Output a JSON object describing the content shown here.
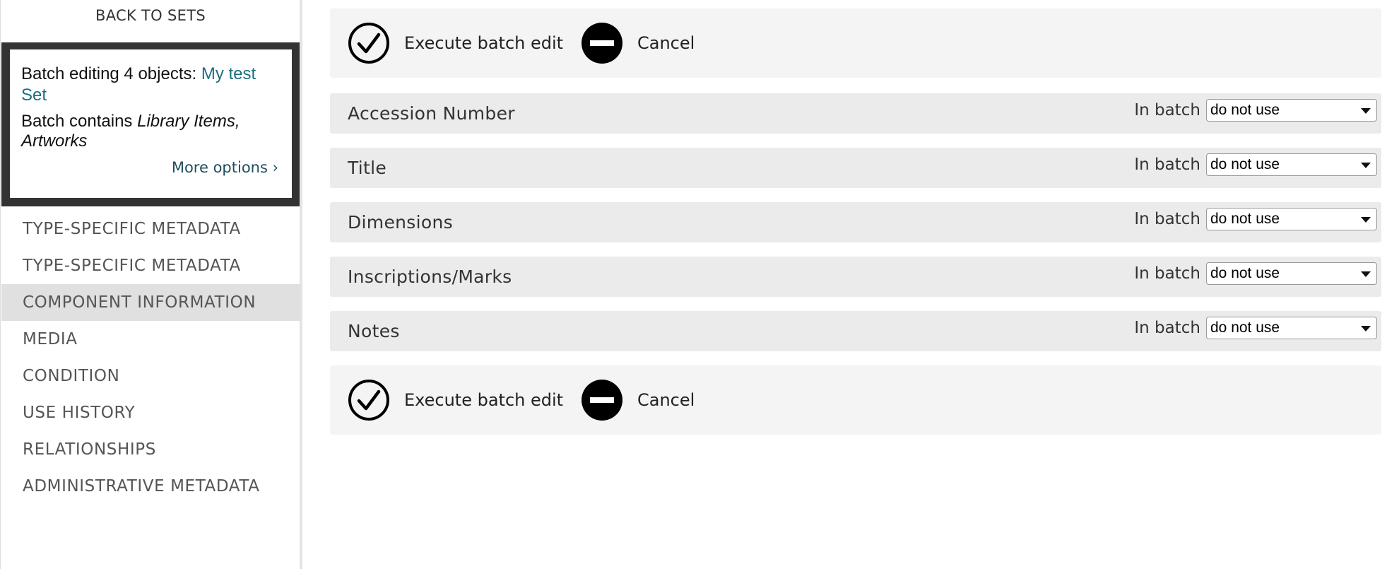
{
  "sidebar": {
    "back_label": "BACK TO SETS",
    "info": {
      "editing_prefix": "Batch editing 4 objects: ",
      "set_name": "My test Set",
      "contains_prefix": "Batch contains ",
      "contains_types": "Library Items, Artworks",
      "more_options": "More options ›"
    },
    "nav": [
      {
        "label": "TYPE-SPECIFIC METADATA",
        "active": false
      },
      {
        "label": "TYPE-SPECIFIC METADATA",
        "active": false
      },
      {
        "label": "COMPONENT INFORMATION",
        "active": true
      },
      {
        "label": "MEDIA",
        "active": false
      },
      {
        "label": "CONDITION",
        "active": false
      },
      {
        "label": "USE HISTORY",
        "active": false
      },
      {
        "label": "RELATIONSHIPS",
        "active": false
      },
      {
        "label": "ADMINISTRATIVE METADATA",
        "active": false
      }
    ]
  },
  "actions": {
    "execute_label": "Execute batch edit",
    "cancel_label": "Cancel"
  },
  "fields": [
    {
      "label": "Accession Number",
      "batch_label": "In batch",
      "value": "do not use"
    },
    {
      "label": "Title",
      "batch_label": "In batch",
      "value": "do not use"
    },
    {
      "label": "Dimensions",
      "batch_label": "In batch",
      "value": "do not use"
    },
    {
      "label": "Inscriptions/Marks",
      "batch_label": "In batch",
      "value": "do not use"
    },
    {
      "label": "Notes",
      "batch_label": "In batch",
      "value": "do not use"
    }
  ],
  "colors": {
    "accent": "#1c6f80",
    "info_box_border": "#333333",
    "active_nav_bg": "#e0e0e0",
    "field_row_bg": "#ebebeb",
    "action_bar_bg": "#f4f4f4"
  },
  "icons": {
    "execute": "check-circle-icon",
    "cancel": "minus-circle-icon",
    "select": "caret-down-icon"
  }
}
